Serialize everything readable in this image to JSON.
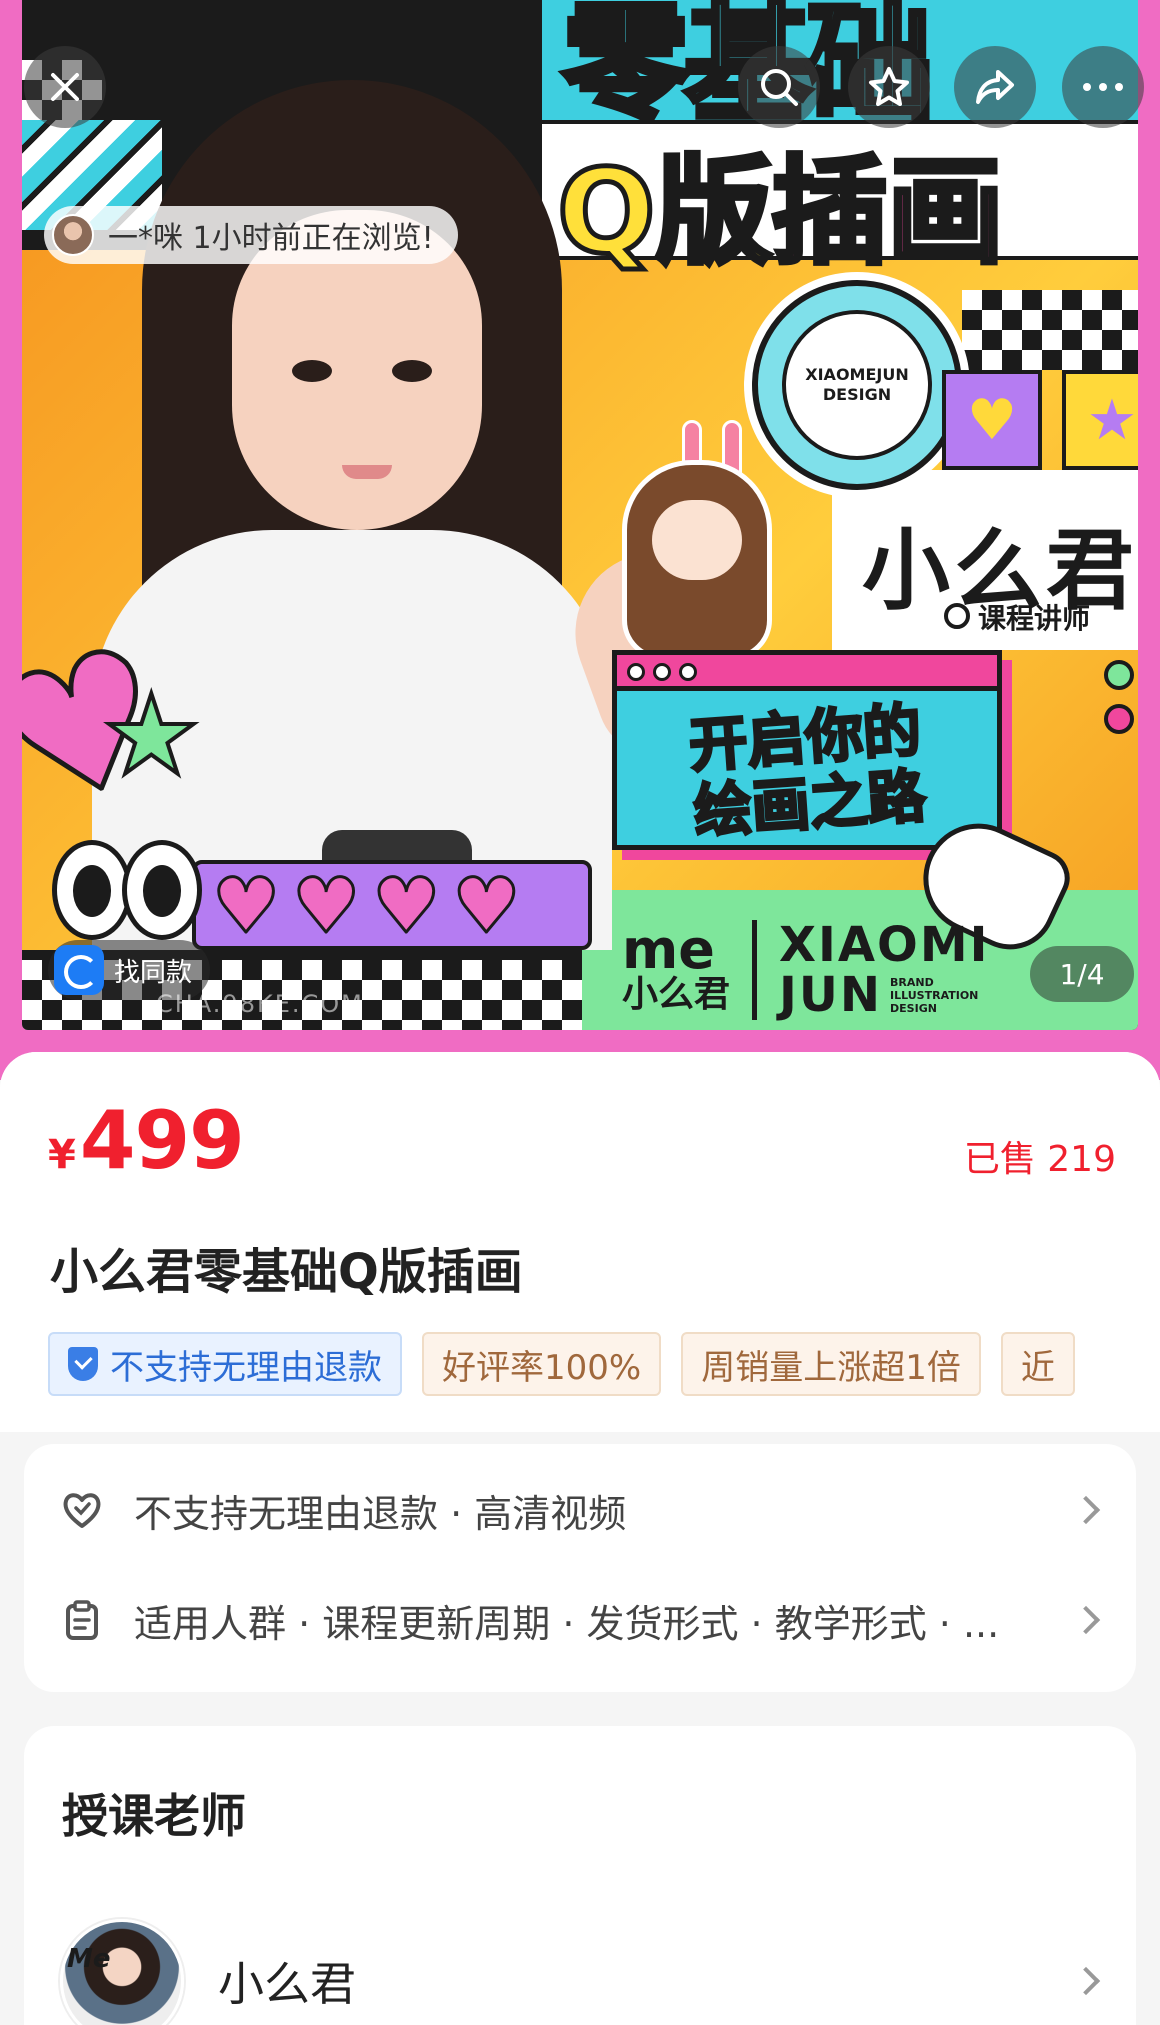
{
  "hero": {
    "title_line1": "零基础",
    "title_line2_a": "Q版",
    "title_line2_b": "插画",
    "badge_text": "XIAOMEJUN DESIGN",
    "teacher_name": "小么君",
    "teacher_role": "课程讲师",
    "window_text_1": "开启你的",
    "window_text_2": "绘画之路",
    "brand_me": "me",
    "brand_cn": "小么君",
    "brand_en_1": "XIAOMI",
    "brand_en_2": "JUN",
    "brand_small": "BRAND ILLUSTRATION DESIGN"
  },
  "overlay": {
    "browsing_text": "一*咪 1小时前正在浏览!",
    "find_same_label": "找同款",
    "watermark": "CHA.98KE.COM",
    "page_indicator": "1/4"
  },
  "product": {
    "currency": "¥",
    "price": "499",
    "sold": "已售 219",
    "title": "小么君零基础Q版插画",
    "tags": [
      "不支持无理由退款",
      "好评率100%",
      "周销量上涨超1倍",
      "近"
    ]
  },
  "service": {
    "row1": "不支持无理由退款 · 高清视频",
    "row2": "适用人群 · 课程更新周期 · 发货形式 · 教学形式 · ..."
  },
  "teacher_section": {
    "title": "授课老师",
    "name": "小么君",
    "avatar_badge": "Me"
  },
  "colors": {
    "price_red": "#f0202e",
    "hero_pink": "#f06cc3",
    "accent_teal": "#3ecfe0",
    "accent_yellow": "#ffe03a"
  }
}
